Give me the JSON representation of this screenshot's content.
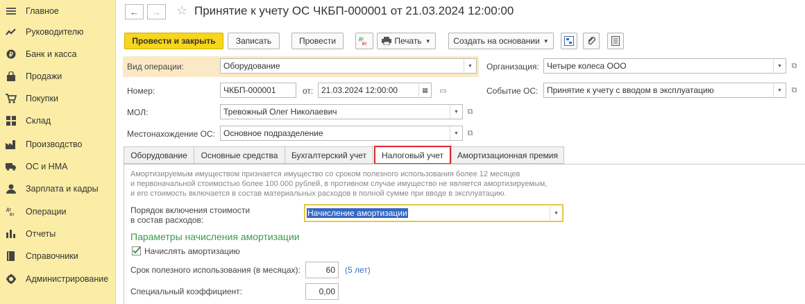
{
  "sidebar": {
    "items": [
      {
        "label": "Главное",
        "icon": "menu-icon"
      },
      {
        "label": "Руководителю",
        "icon": "trend-icon"
      },
      {
        "label": "Банк и касса",
        "icon": "coin-icon"
      },
      {
        "label": "Продажи",
        "icon": "bag-icon"
      },
      {
        "label": "Покупки",
        "icon": "cart-icon"
      },
      {
        "label": "Склад",
        "icon": "warehouse-icon"
      },
      {
        "label": "Производство",
        "icon": "factory-icon"
      },
      {
        "label": "ОС и НМА",
        "icon": "truck-icon"
      },
      {
        "label": "Зарплата и кадры",
        "icon": "person-icon"
      },
      {
        "label": "Операции",
        "icon": "dt-kt-icon"
      },
      {
        "label": "Отчеты",
        "icon": "bar-chart-icon"
      },
      {
        "label": "Справочники",
        "icon": "book-icon"
      },
      {
        "label": "Администрирование",
        "icon": "gear-icon"
      }
    ]
  },
  "header": {
    "back": "←",
    "forward": "→",
    "star": "☆",
    "title": "Принятие к учету ОС ЧКБП-000001 от 21.03.2024 12:00:00"
  },
  "toolbar": {
    "post_close": "Провести и закрыть",
    "save": "Записать",
    "post": "Провести",
    "dt_kt": "Дт Кт",
    "print": "Печать",
    "create_based": "Создать на основании"
  },
  "form": {
    "operation_label": "Вид операции:",
    "operation_value": "Оборудование",
    "org_label": "Организация:",
    "org_value": "Четыре колеса ООО",
    "number_label": "Номер:",
    "number_value": "ЧКБП-000001",
    "date_label": "от:",
    "date_value": "21.03.2024 12:00:00",
    "event_label": "Событие ОС:",
    "event_value": "Принятие к учету с вводом в эксплуатацию",
    "mol_label": "МОЛ:",
    "mol_value": "Тревожный Олег Николаевич",
    "location_label": "Местонахождение ОС:",
    "location_value": "Основное подразделение"
  },
  "tabs": [
    {
      "label": "Оборудование"
    },
    {
      "label": "Основные средства"
    },
    {
      "label": "Бухгалтерский учет"
    },
    {
      "label": "Налоговый учет",
      "active": true
    },
    {
      "label": "Амортизационная премия"
    }
  ],
  "tax": {
    "note1": "Амортизируемым имуществом признается имущество со сроком полезного использования более 12 месяцев",
    "note2": "и первоначальной стоимостью более 100 000 рублей, в противном случае имущество не является амортизируемым,",
    "note3": "и его стоимость включается в состав материальных расходов в полной сумме при вводе в эксплуатацию.",
    "order_label1": "Порядок включения стоимости",
    "order_label2": "в состав расходов:",
    "order_value": "Начисление амортизации",
    "params_heading": "Параметры начисления амортизации",
    "accrue_label": "Начислять амортизацию",
    "accrue_checked": true,
    "term_label": "Срок полезного использования (в месяцах):",
    "term_value": "60",
    "term_years": "(5 лет)",
    "coef_label": "Специальный коэффициент:",
    "coef_value": "0,00"
  },
  "colors": {
    "sidebar_bg": "#fbeda5",
    "primary_button": "#f7d61b",
    "active_tab_border": "#d9262c",
    "heading_green": "#3a9a4a",
    "link_blue": "#3a6ec0"
  }
}
